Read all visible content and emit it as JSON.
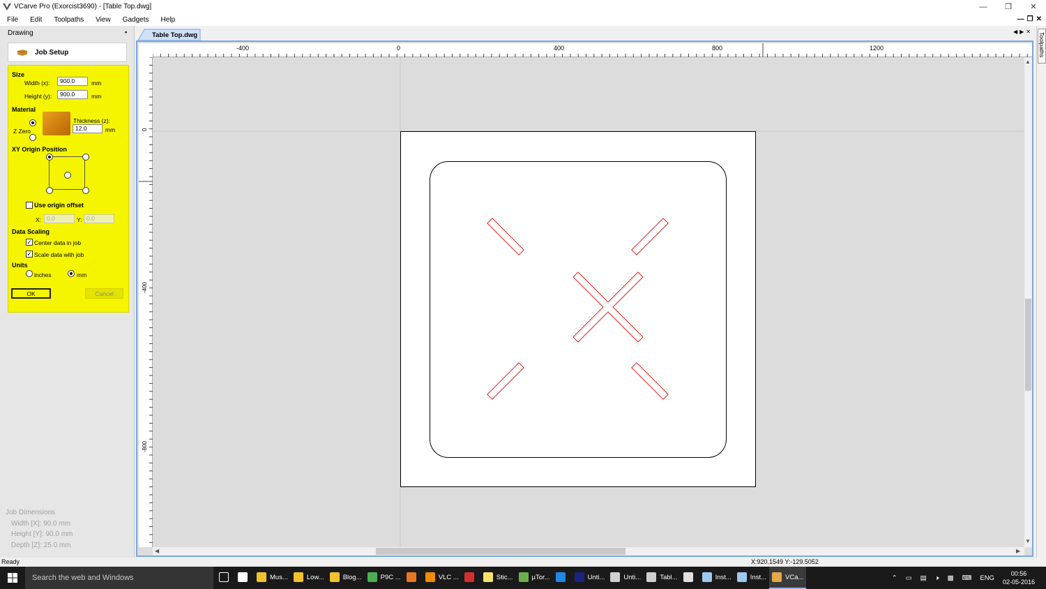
{
  "window": {
    "title": "VCarve Pro (Exorcist3690) - [Table Top.dwg]"
  },
  "menu": [
    "File",
    "Edit",
    "Toolpaths",
    "View",
    "Gadgets",
    "Help"
  ],
  "left_panel": {
    "title": "Drawing",
    "job_tab": "Job Setup",
    "form": {
      "size_label": "Size",
      "width_label": "Width (x):",
      "width_value": "900.0",
      "width_unit": "mm",
      "height_label": "Height (y):",
      "height_value": "900.0",
      "height_unit": "mm",
      "material_label": "Material",
      "z_zero_label": "Z Zero",
      "thickness_label": "Thickness (z):",
      "thickness_value": "12.0",
      "thickness_unit": "mm",
      "origin_label": "XY Origin Position",
      "use_origin_offset": "Use origin offset",
      "x_label": "X:",
      "x_value": "0.0",
      "y_label": "Y:",
      "y_value": "0.0",
      "data_scaling_label": "Data Scaling",
      "center_data": "Center data in job",
      "scale_data": "Scale data with job",
      "units_label": "Units",
      "inches": "inches",
      "mm": "mm",
      "ok": "OK",
      "cancel": "Cancel"
    },
    "job_dimensions": {
      "title": "Job Dimensions",
      "width": "Width  [X]: 90.0 mm",
      "height": "Height [Y]: 90.0 mm",
      "depth": "Depth  [Z]: 25.0 mm"
    }
  },
  "document": {
    "tab": "Table Top.dwg",
    "hruler_labels": [
      "-400",
      "0",
      "400",
      "800",
      "1200"
    ],
    "vruler_labels": [
      "0",
      "-400",
      "-800"
    ]
  },
  "toolpaths_tab": "Toolpaths",
  "status": {
    "text": "Ready",
    "coords": "X:920.1549 Y:-129.5052"
  },
  "taskbar": {
    "search_placeholder": "Search the web and Windows",
    "items": [
      {
        "label": "Mus...",
        "color": "#f2c12e"
      },
      {
        "label": "Low...",
        "color": "#f2c12e"
      },
      {
        "label": "Blog...",
        "color": "#f2c12e"
      },
      {
        "label": "P9C ...",
        "color": "#4caf50"
      },
      {
        "label": "",
        "color": "#e87722"
      },
      {
        "label": "VLC ...",
        "color": "#f08c00"
      },
      {
        "label": "",
        "color": "#d32f2f"
      },
      {
        "label": "Stic...",
        "color": "#f7e26b"
      },
      {
        "label": "µTor...",
        "color": "#6ab04c"
      },
      {
        "label": "",
        "color": "#1e88e5"
      },
      {
        "label": "Unti...",
        "color": "#1a237e"
      },
      {
        "label": "Unti...",
        "color": "#cfcfcf"
      },
      {
        "label": "Tabl...",
        "color": "#cfcfcf"
      },
      {
        "label": "",
        "color": "#e0e0e0"
      },
      {
        "label": "Inst...",
        "color": "#9ec9f0"
      },
      {
        "label": "Inst...",
        "color": "#9ec9f0"
      },
      {
        "label": "VCa...",
        "color": "#e6a64a"
      }
    ],
    "language": "ENG",
    "time": "00:56",
    "date": "02-05-2016"
  }
}
